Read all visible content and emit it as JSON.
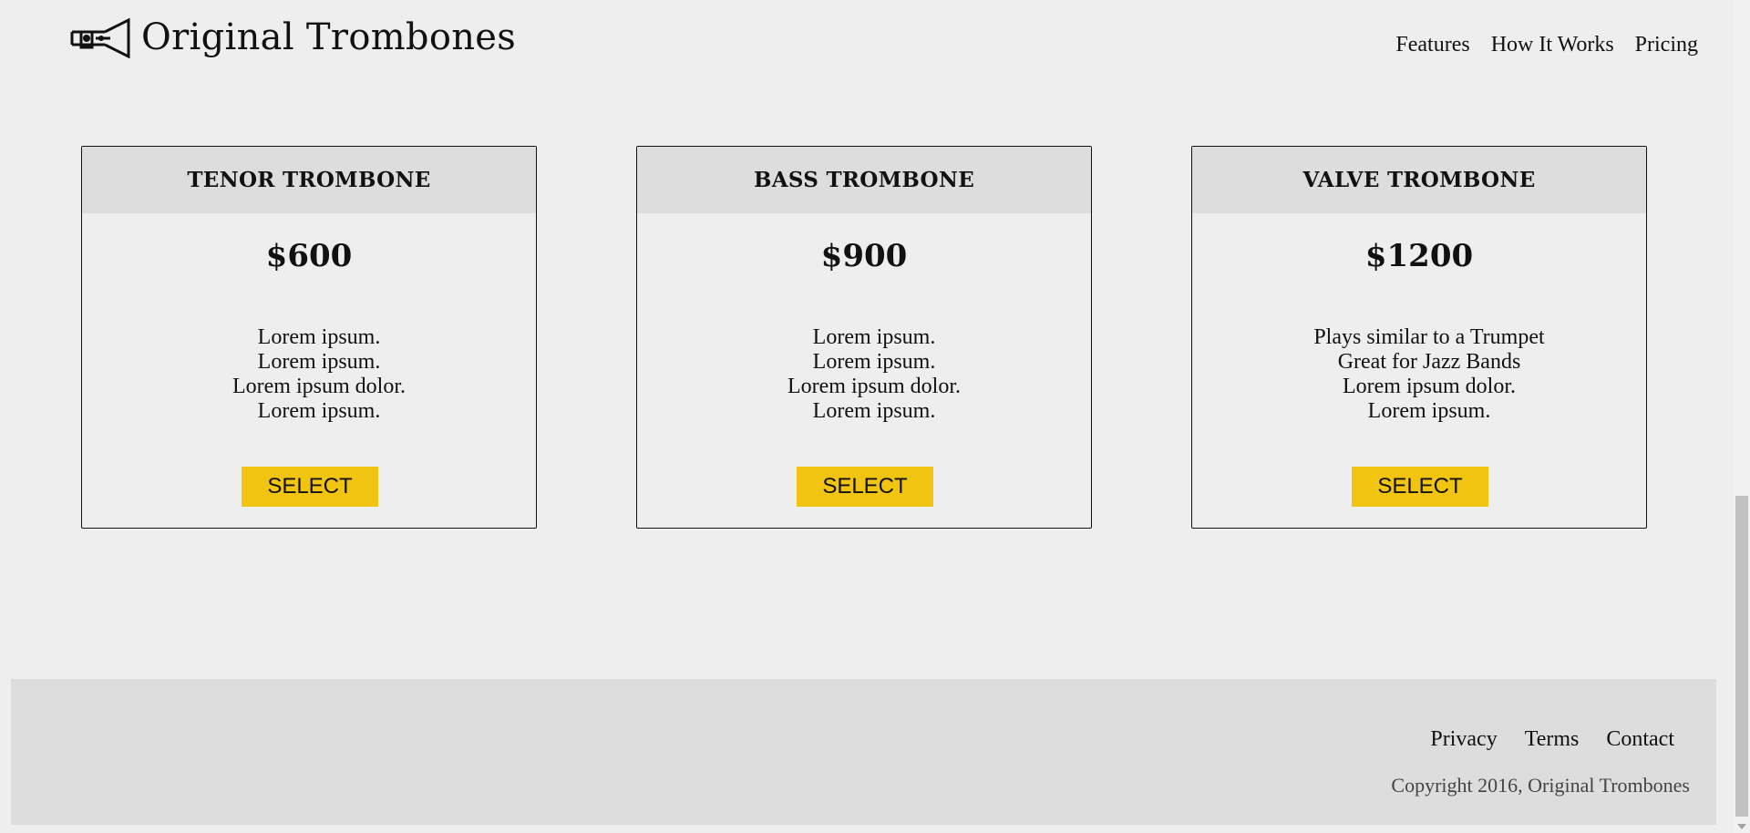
{
  "header": {
    "brand_title": "Original Trombones",
    "logo_icon": "trombone-logo-icon",
    "nav": [
      {
        "label": "Features"
      },
      {
        "label": "How It Works"
      },
      {
        "label": "Pricing"
      }
    ]
  },
  "cards": [
    {
      "title": "TENOR TROMBONE",
      "price": "$600",
      "features": [
        "Lorem ipsum.",
        "Lorem ipsum.",
        "Lorem ipsum dolor.",
        "Lorem ipsum."
      ],
      "button_label": "SELECT"
    },
    {
      "title": "BASS TROMBONE",
      "price": "$900",
      "features": [
        "Lorem ipsum.",
        "Lorem ipsum.",
        "Lorem ipsum dolor.",
        "Lorem ipsum."
      ],
      "button_label": "SELECT"
    },
    {
      "title": "VALVE TROMBONE",
      "price": "$1200",
      "features": [
        "Plays similar to a Trumpet",
        "Great for Jazz Bands",
        "Lorem ipsum dolor.",
        "Lorem ipsum."
      ],
      "button_label": "SELECT"
    }
  ],
  "footer": {
    "links": [
      {
        "label": "Privacy"
      },
      {
        "label": "Terms"
      },
      {
        "label": "Contact"
      }
    ],
    "copyright": "Copyright 2016, Original Trombones"
  },
  "colors": {
    "background": "#eeeeee",
    "card_header": "#dddddd",
    "button": "#f1c40f",
    "footer": "#dddddd"
  }
}
